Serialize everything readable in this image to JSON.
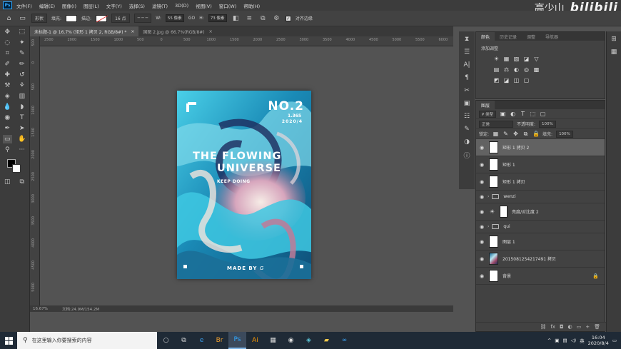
{
  "menubar": {
    "logo": "Ps",
    "items": [
      "文件(F)",
      "编辑(E)",
      "图像(I)",
      "图层(L)",
      "文字(Y)",
      "选择(S)",
      "滤镜(T)",
      "3D(D)",
      "视图(V)",
      "窗口(W)",
      "帮助(H)"
    ],
    "watermark_name": "高少山",
    "watermark_logo": "bilibili"
  },
  "options": {
    "shape_mode": "形状",
    "fill_label": "填充:",
    "stroke_label": "描边:",
    "stroke_size": "16 点",
    "w_label": "W:",
    "w_value": "55 像素",
    "link": "GO",
    "h_label": "H:",
    "h_value": "73 像素",
    "align_edges": "对齐边缘"
  },
  "tabs": [
    {
      "label": "未标题-1 @ 16.7% (矩形 1 拷贝 2, RGB/8#) *",
      "close": "×"
    },
    {
      "label": "国图 2.jpg @ 66.7%(RGB/8#)",
      "close": "×"
    }
  ],
  "ruler": {
    "top": [
      "2500",
      "2000",
      "1500",
      "1000",
      "500",
      "0",
      "500",
      "1000",
      "1500",
      "2000",
      "2500",
      "3000",
      "3500",
      "4000",
      "4500",
      "5000",
      "5500",
      "6000"
    ],
    "left": [
      "500",
      "0",
      "500",
      "1000",
      "1500",
      "2000",
      "2500",
      "3000",
      "3500",
      "4000",
      "4500",
      "5000"
    ]
  },
  "poster": {
    "number": "NO.2",
    "subtitle": "1.365",
    "date": "2020/4",
    "title_line1": "THE FLOWING",
    "title_line2": "UNIVERSE",
    "tagline": "KEEP DOING",
    "footer": "MADE BY",
    "footer_sig": "G",
    "colors": {
      "cyan": "#3fc4df",
      "teal": "#0e6f93",
      "pink": "#c98aa5",
      "cream": "#f4e7de",
      "navy": "#1a2650"
    }
  },
  "status": {
    "zoom": "16.67%",
    "doc": "文档:24.9M/154.2M"
  },
  "adjust_panel": {
    "tabs": [
      "颜色",
      "历史记录",
      "调整",
      "导航器"
    ],
    "active_tab": "颜色",
    "title": "添加调整",
    "icons_row1": [
      "☀",
      "▦",
      "▨",
      "◪",
      "▽"
    ],
    "icons_row2": [
      "▤",
      "⚖",
      "◐",
      "◎",
      "▩"
    ],
    "icons_row3": [
      "◩",
      "◪",
      "◫",
      "▢"
    ]
  },
  "layers_panel": {
    "tab": "图层",
    "kind": "P 类型",
    "blend": "正常",
    "opacity_label": "不透明度:",
    "opacity": "100%",
    "lock_label": "锁定:",
    "fill_label": "填充:",
    "fill": "100%",
    "layers": [
      {
        "name": "矩形 1 拷贝 2",
        "type": "shape",
        "selected": true
      },
      {
        "name": "矩形 1",
        "type": "shape",
        "selected": false
      },
      {
        "name": "矩形 1 拷贝",
        "type": "shape",
        "selected": false
      },
      {
        "name": "wenzi",
        "type": "folder",
        "selected": false
      },
      {
        "name": "亮度/对比度 2",
        "type": "adjustment",
        "selected": false
      },
      {
        "name": "qui",
        "type": "folder",
        "selected": false
      },
      {
        "name": "图层 1",
        "type": "plain",
        "selected": false
      },
      {
        "name": "20150812542174​91 拷贝",
        "type": "photo",
        "selected": false
      },
      {
        "name": "背景",
        "type": "background",
        "selected": false
      }
    ],
    "bottom_icons": [
      "⛓",
      "fx",
      "◘",
      "◐",
      "▭",
      "+",
      "🗑"
    ]
  },
  "taskbar": {
    "search_placeholder": "在这里输入你要搜索的内容",
    "apps": [
      "○",
      "⧉",
      "e",
      "Br",
      "Ps",
      "Ai",
      "▦",
      "◉",
      "◈",
      "▰",
      "∞"
    ],
    "active_app": "Ps",
    "tray_lang": "英",
    "time": "16:04",
    "date": "2020/8/4"
  }
}
